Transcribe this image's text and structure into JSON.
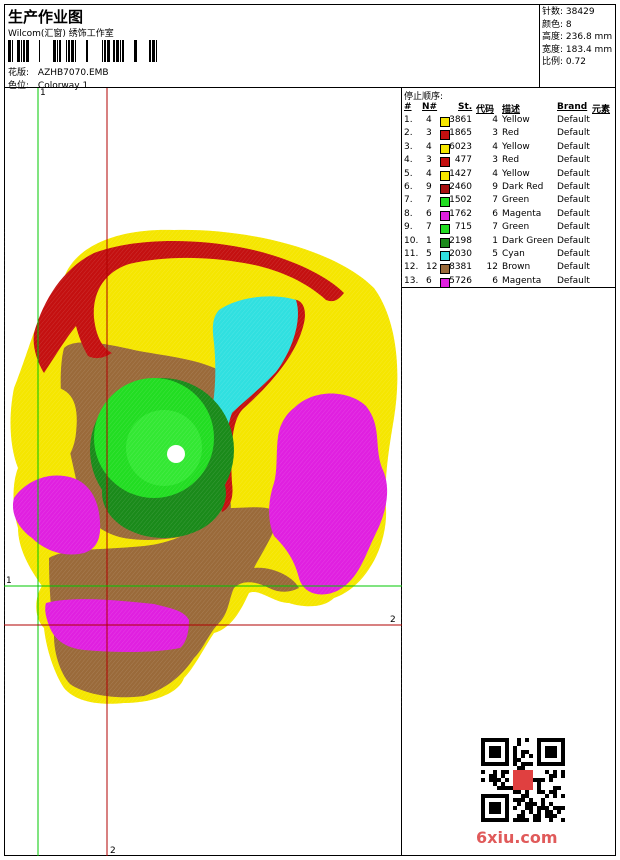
{
  "header": {
    "title": "生产作业图",
    "subtitle": "Wilcom(汇窗) 绣饰工作室",
    "design_label": "花版:",
    "design_value": "AZHB7070.EMB",
    "colorway_label": "色位:",
    "colorway_value": "Colorway 1"
  },
  "stats": [
    {
      "label": "针数:",
      "value": "38429"
    },
    {
      "label": "颜色:",
      "value": "8"
    },
    {
      "label": "高度:",
      "value": "236.8 mm"
    },
    {
      "label": "宽度:",
      "value": "183.4 mm"
    },
    {
      "label": "比例:",
      "value": "0.72"
    }
  ],
  "stop_sequence": {
    "title": "停止顺序:",
    "headers": {
      "num": "#",
      "needle": "N#",
      "stitches": "St.",
      "code": "代码",
      "desc": "描述",
      "brand": "Brand",
      "elem": "元素"
    },
    "rows": [
      {
        "num": "1.",
        "needle": "4",
        "color": "#f5e600",
        "stitches": "3861",
        "code": "4",
        "desc": "Yellow",
        "brand": "Default"
      },
      {
        "num": "2.",
        "needle": "3",
        "color": "#c41010",
        "stitches": "1865",
        "code": "3",
        "desc": "Red",
        "brand": "Default"
      },
      {
        "num": "3.",
        "needle": "4",
        "color": "#f5e600",
        "stitches": "6023",
        "code": "4",
        "desc": "Yellow",
        "brand": "Default"
      },
      {
        "num": "4.",
        "needle": "3",
        "color": "#c41010",
        "stitches": "477",
        "code": "3",
        "desc": "Red",
        "brand": "Default"
      },
      {
        "num": "5.",
        "needle": "4",
        "color": "#f5e600",
        "stitches": "1427",
        "code": "4",
        "desc": "Yellow",
        "brand": "Default"
      },
      {
        "num": "6.",
        "needle": "9",
        "color": "#a81010",
        "stitches": "2460",
        "code": "9",
        "desc": "Dark Red",
        "brand": "Default"
      },
      {
        "num": "7.",
        "needle": "7",
        "color": "#22dd22",
        "stitches": "1502",
        "code": "7",
        "desc": "Green",
        "brand": "Default"
      },
      {
        "num": "8.",
        "needle": "6",
        "color": "#e020e0",
        "stitches": "1762",
        "code": "6",
        "desc": "Magenta",
        "brand": "Default"
      },
      {
        "num": "9.",
        "needle": "7",
        "color": "#22dd22",
        "stitches": "715",
        "code": "7",
        "desc": "Green",
        "brand": "Default"
      },
      {
        "num": "10.",
        "needle": "1",
        "color": "#1a8a1a",
        "stitches": "2198",
        "code": "1",
        "desc": "Dark Green",
        "brand": "Default"
      },
      {
        "num": "11.",
        "needle": "5",
        "color": "#30e0e0",
        "stitches": "2030",
        "code": "5",
        "desc": "Cyan",
        "brand": "Default"
      },
      {
        "num": "12.",
        "needle": "12",
        "color": "#9a6a3a",
        "stitches": "8381",
        "code": "12",
        "desc": "Brown",
        "brand": "Default"
      },
      {
        "num": "13.",
        "needle": "6",
        "color": "#e020e0",
        "stitches": "5726",
        "code": "6",
        "desc": "Magenta",
        "brand": "Default"
      }
    ]
  },
  "markers": {
    "v1": "1",
    "h1": "1",
    "h2": "2",
    "v2": "2"
  },
  "watermark": "6xiu.com",
  "colors": {
    "yellow": "#f5e600",
    "red": "#c41010",
    "green": "#22dd22",
    "dark_green": "#1a8a1a",
    "cyan": "#30e0e0",
    "brown": "#9a6a3a",
    "magenta": "#e020e0",
    "guide_green": "#00c800",
    "guide_red": "#b00000"
  }
}
